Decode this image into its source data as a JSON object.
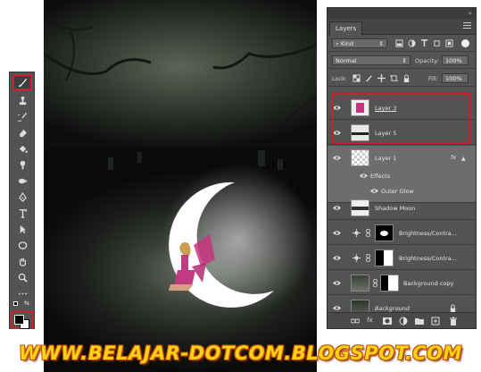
{
  "layers_panel": {
    "tab_label": "Layers",
    "collapse_glyph": "»",
    "filter": {
      "kind_label": "Kind"
    },
    "blend_mode": "Normal",
    "opacity_label": "Opacity:",
    "opacity_value": "100%",
    "lock_label": "Lock:",
    "fill_label": "Fill:",
    "fill_value": "100%",
    "fx_glyph": "fx",
    "layers": [
      {
        "name": "Layer 3"
      },
      {
        "name": "Layer 5"
      },
      {
        "name": "Layer 1",
        "effects_label": "Effects",
        "effect": "Outer Glow"
      },
      {
        "name": "Shadow Moon"
      },
      {
        "name": "Brightness/Contra..."
      },
      {
        "name": "Brightness/Contra..."
      },
      {
        "name": "Background copy"
      },
      {
        "name": "Background"
      }
    ]
  },
  "toolbar": {
    "tools": [
      "brush-icon",
      "stamp-icon",
      "history-brush-icon",
      "eraser-icon",
      "paint-bucket-icon",
      "smudge-icon",
      "dodge-icon",
      "pen-icon",
      "type-icon",
      "path-select-icon",
      "ellipse-icon",
      "hand-icon",
      "zoom-icon",
      "more-icon"
    ],
    "active_tool": "brush-icon",
    "foreground_color": "#000000",
    "background_color": "#ffffff"
  },
  "watermark": "WWW.BELAJAR-DOTCOM.BLOGSPOT.COM",
  "colors": {
    "highlight": "#d01f2a",
    "panel": "#535353",
    "watermark": "#ffd21a"
  }
}
